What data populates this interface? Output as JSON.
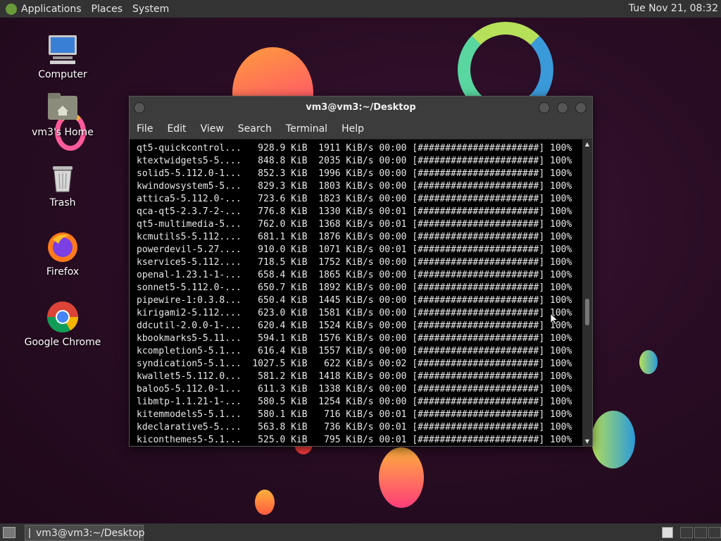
{
  "top_panel": {
    "menus": [
      "Applications",
      "Places",
      "System"
    ],
    "clock": "Tue Nov 21, 08:32"
  },
  "desktop_icons": [
    {
      "label": "Computer",
      "icon": "computer-icon"
    },
    {
      "label": "vm3's Home",
      "icon": "home-folder-icon"
    },
    {
      "label": "Trash",
      "icon": "trash-icon"
    },
    {
      "label": "Firefox",
      "icon": "firefox-icon"
    },
    {
      "label": "Google Chrome",
      "icon": "chrome-icon"
    }
  ],
  "terminal": {
    "title": "vm3@vm3:~/Desktop",
    "menu": [
      "File",
      "Edit",
      "View",
      "Search",
      "Terminal",
      "Help"
    ],
    "lines": [
      "qt5-quickcontrol...   928.9 KiB  1911 KiB/s 00:00 [######################] 100%",
      "ktextwidgets5-5....   848.8 KiB  2035 KiB/s 00:00 [######################] 100%",
      "solid5-5.112.0-1...   852.3 KiB  1996 KiB/s 00:00 [######################] 100%",
      "kwindowsystem5-5...   829.3 KiB  1803 KiB/s 00:00 [######################] 100%",
      "attica5-5.112.0-...   723.6 KiB  1823 KiB/s 00:00 [######################] 100%",
      "qca-qt5-2.3.7-2-...   776.8 KiB  1330 KiB/s 00:01 [######################] 100%",
      "qt5-multimedia-5...   762.0 KiB  1368 KiB/s 00:01 [######################] 100%",
      "kcmutils5-5.112....   681.1 KiB  1876 KiB/s 00:00 [######################] 100%",
      "powerdevil-5.27....   910.0 KiB  1071 KiB/s 00:01 [######################] 100%",
      "kservice5-5.112....   718.5 KiB  1752 KiB/s 00:00 [######################] 100%",
      "openal-1.23.1-1-...   658.4 KiB  1865 KiB/s 00:00 [######################] 100%",
      "sonnet5-5.112.0-...   650.7 KiB  1892 KiB/s 00:00 [######################] 100%",
      "pipewire-1:0.3.8...   650.4 KiB  1445 KiB/s 00:00 [######################] 100%",
      "kirigami2-5.112....   623.0 KiB  1581 KiB/s 00:00 [######################] 100%",
      "ddcutil-2.0.0-1-...   620.4 KiB  1524 KiB/s 00:00 [######################] 100%",
      "kbookmarks5-5.11...   594.1 KiB  1576 KiB/s 00:00 [######################] 100%",
      "kcompletion5-5.1...   616.4 KiB  1557 KiB/s 00:00 [######################] 100%",
      "syndication5-5.1...  1027.5 KiB   622 KiB/s 00:02 [######################] 100%",
      "kwallet5-5.112.0...   581.2 KiB  1418 KiB/s 00:00 [######################] 100%",
      "baloo5-5.112.0-1...   611.3 KiB  1338 KiB/s 00:00 [######################] 100%",
      "libmtp-1.1.21-1-...   580.5 KiB  1254 KiB/s 00:00 [######################] 100%",
      "kitemmodels5-5.1...   580.1 KiB   716 KiB/s 00:01 [######################] 100%",
      "kdeclarative5-5....   563.8 KiB   736 KiB/s 00:01 [######################] 100%",
      "kiconthemes5-5.1...   525.0 KiB   795 KiB/s 00:01 [######################] 100%"
    ]
  },
  "taskbar": {
    "task_label": "vm3@vm3:~/Desktop"
  }
}
